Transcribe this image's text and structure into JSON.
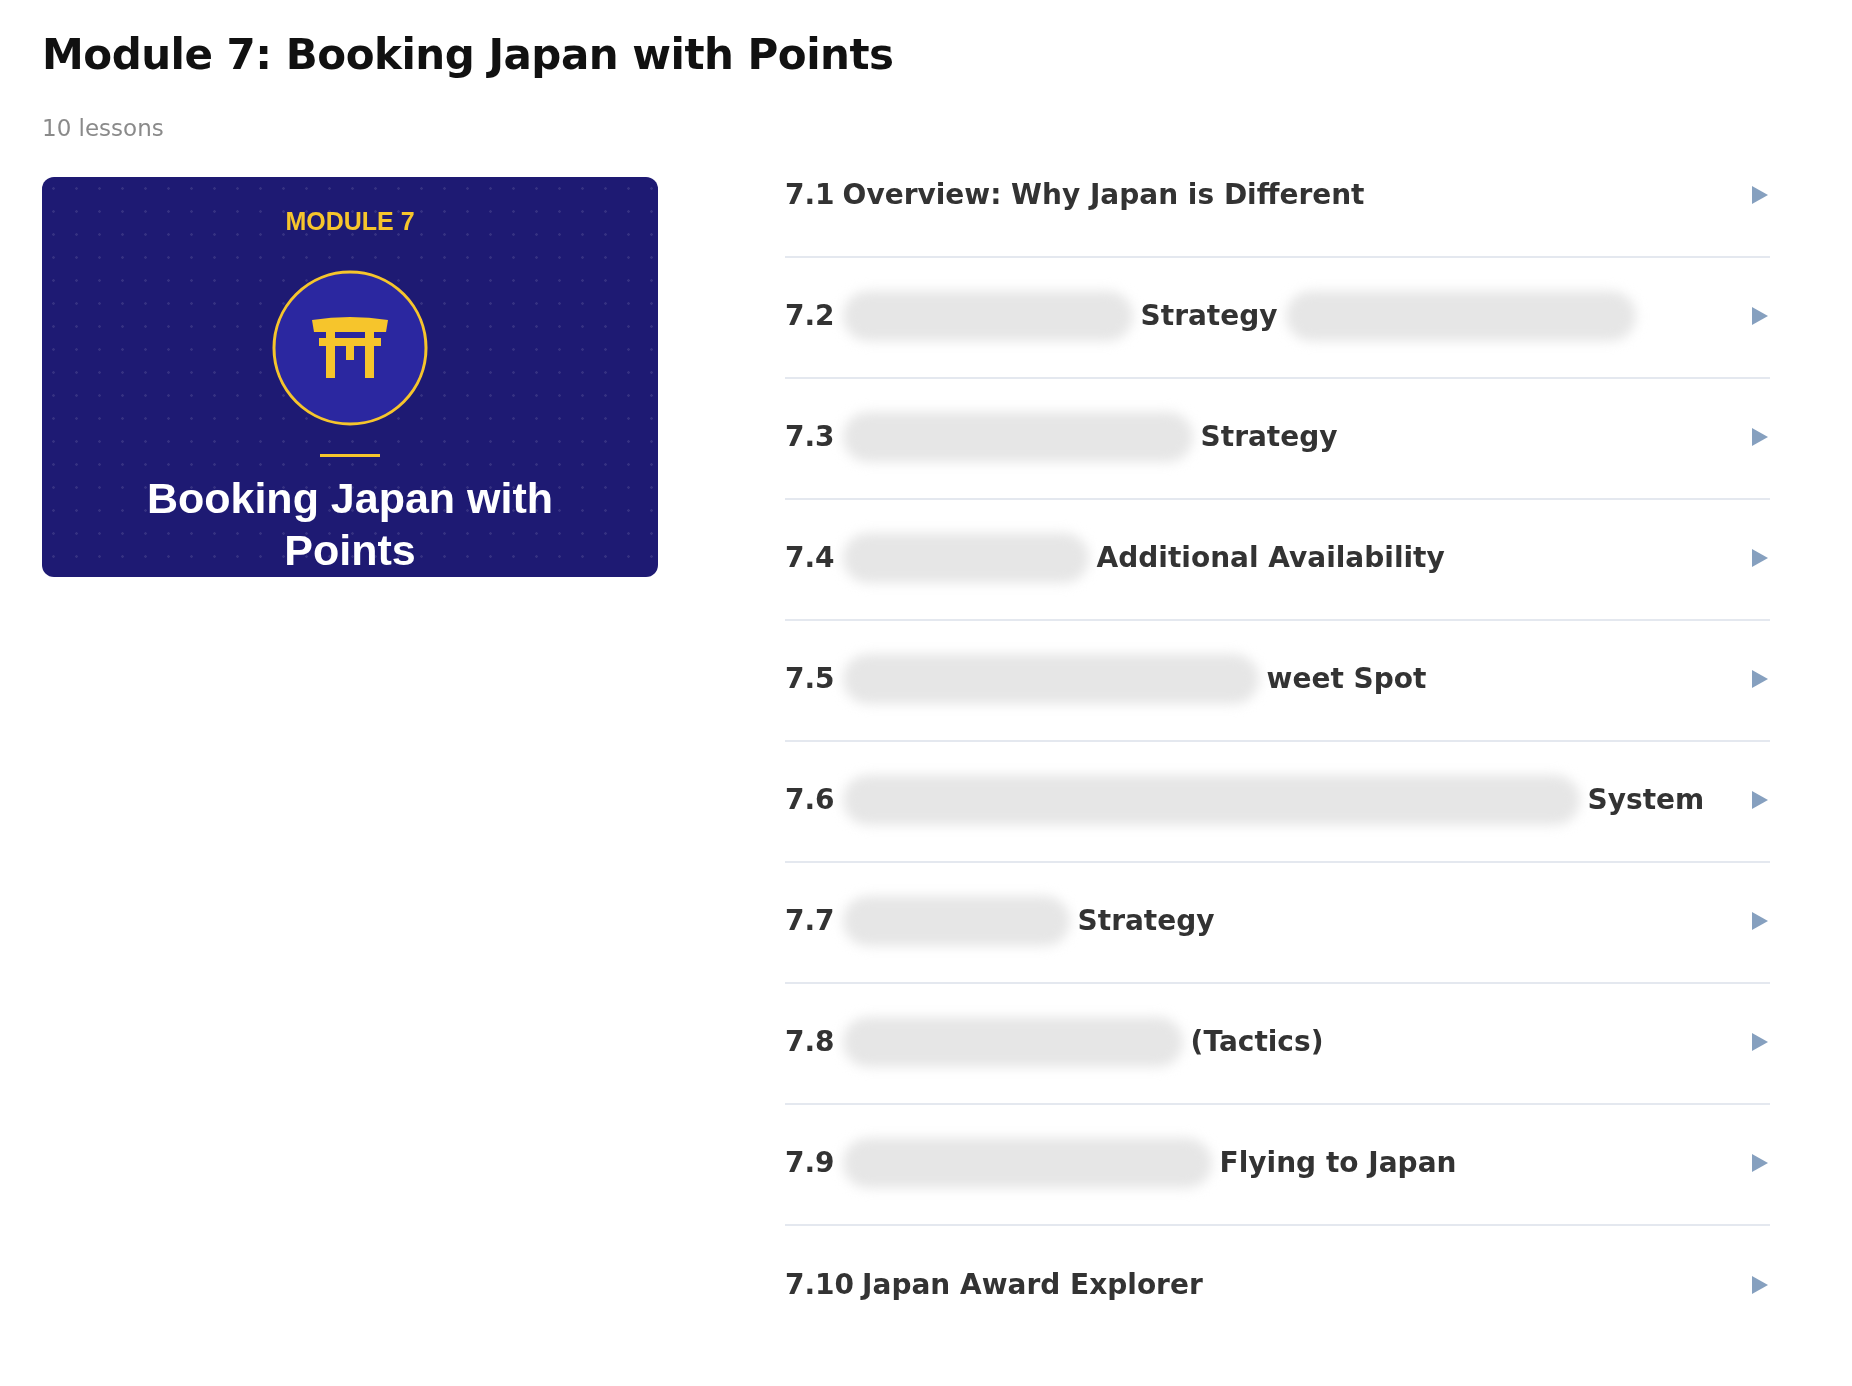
{
  "module": {
    "title": "Module 7: Booking Japan with Points",
    "lesson_count": "10 lessons"
  },
  "cover": {
    "eyebrow": "MODULE 7",
    "title": "Booking Japan with Points"
  },
  "lessons": [
    {
      "number": "7.1",
      "parts": [
        {
          "kind": "text",
          "text": "Overview: Why Japan is Different"
        }
      ]
    },
    {
      "number": "7.2",
      "parts": [
        {
          "kind": "redaction"
        },
        {
          "kind": "text",
          "text": "Strategy"
        },
        {
          "kind": "redaction"
        }
      ]
    },
    {
      "number": "7.3",
      "parts": [
        {
          "kind": "redaction"
        },
        {
          "kind": "text",
          "text": "Strategy"
        }
      ]
    },
    {
      "number": "7.4",
      "parts": [
        {
          "kind": "redaction"
        },
        {
          "kind": "text",
          "text": "Additional Availability"
        }
      ]
    },
    {
      "number": "7.5",
      "parts": [
        {
          "kind": "redaction"
        },
        {
          "kind": "text",
          "text": "weet Spot"
        }
      ]
    },
    {
      "number": "7.6",
      "parts": [
        {
          "kind": "redaction"
        },
        {
          "kind": "text",
          "text": "System"
        }
      ]
    },
    {
      "number": "7.7",
      "parts": [
        {
          "kind": "redaction"
        },
        {
          "kind": "text",
          "text": "Strategy"
        }
      ]
    },
    {
      "number": "7.8",
      "parts": [
        {
          "kind": "redaction"
        },
        {
          "kind": "text",
          "text": "(Tactics)"
        }
      ]
    },
    {
      "number": "7.9",
      "parts": [
        {
          "kind": "redaction"
        },
        {
          "kind": "text",
          "text": "Flying to Japan"
        }
      ]
    },
    {
      "number": "7.10",
      "parts": [
        {
          "kind": "text",
          "text": "Japan Award Explorer"
        }
      ]
    }
  ]
}
